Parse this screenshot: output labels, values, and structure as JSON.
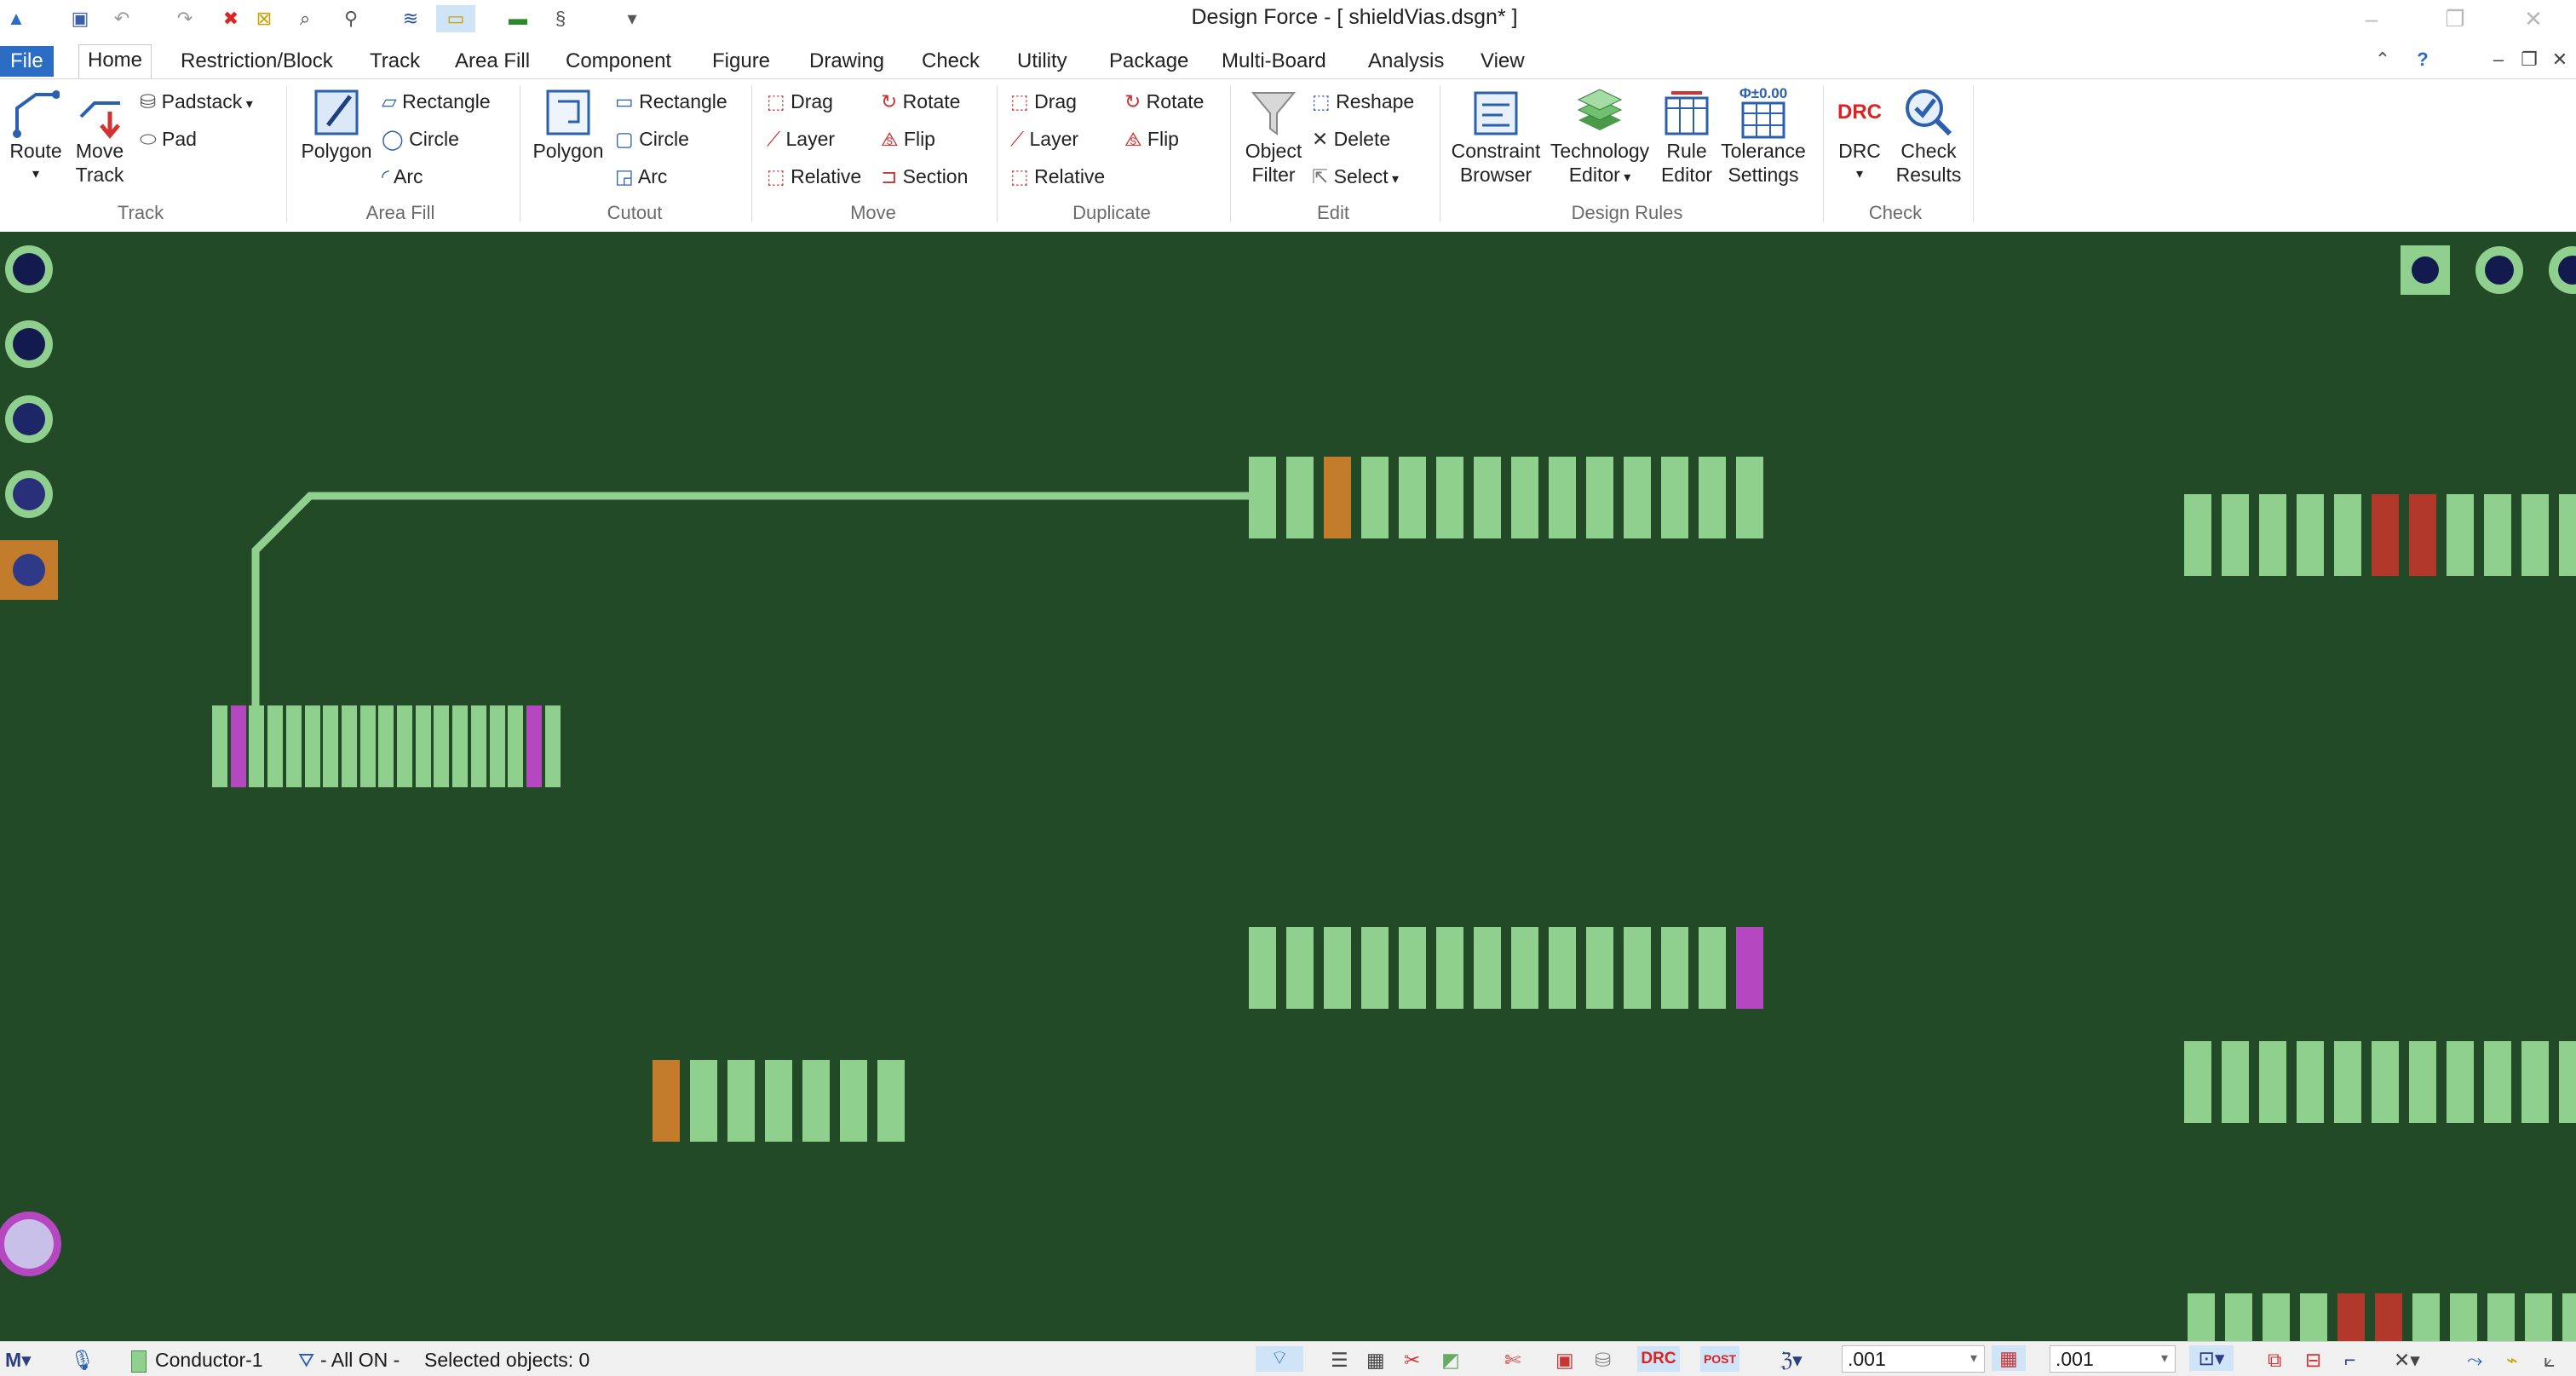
{
  "window": {
    "title": "Design Force - [ shieldVias.dsgn* ]",
    "controls": {
      "minimize": "–",
      "maximize": "❐",
      "close": "✕"
    }
  },
  "tabs": [
    "File",
    "Home",
    "Restriction/Block",
    "Track",
    "Area Fill",
    "Component",
    "Figure",
    "Drawing",
    "Check",
    "Utility",
    "Package",
    "Multi-Board",
    "Analysis",
    "View"
  ],
  "ribbon": {
    "track": {
      "route": "Route",
      "move": "Move",
      "track_label": "Track",
      "padstack": "Padstack",
      "pad": "Pad",
      "group": "Track"
    },
    "area_fill": {
      "polygon": "Polygon",
      "rectangle": "Rectangle",
      "circle": "Circle",
      "arc": "Arc",
      "group": "Area Fill"
    },
    "cutout": {
      "polygon": "Polygon",
      "rectangle": "Rectangle",
      "circle": "Circle",
      "arc": "Arc",
      "group": "Cutout"
    },
    "move": {
      "drag": "Drag",
      "layer": "Layer",
      "relative": "Relative",
      "rotate": "Rotate",
      "flip": "Flip",
      "section": "Section",
      "group": "Move"
    },
    "duplicate": {
      "drag": "Drag",
      "layer": "Layer",
      "relative": "Relative",
      "rotate": "Rotate",
      "flip": "Flip",
      "group": "Duplicate"
    },
    "edit": {
      "object": "Object",
      "filter": "Filter",
      "reshape": "Reshape",
      "delete": "Delete",
      "select": "Select",
      "group": "Edit"
    },
    "design_rules": {
      "constraint": "Constraint",
      "browser": "Browser",
      "technology": "Technology",
      "editor": "Editor",
      "rule": "Rule",
      "rule_editor": "Editor",
      "tolerance": "Tolerance",
      "settings": "Settings",
      "tol_badge": "Φ±0.00",
      "group": "Design Rules"
    },
    "check": {
      "drc": "DRC",
      "drc_badge": "DRC",
      "check": "Check",
      "results": "Results",
      "group": "Check"
    }
  },
  "status": {
    "layer": "Conductor-1",
    "filter": "- All ON -",
    "selected": "Selected objects: 0",
    "drc_badge": "DRC",
    "post_badge": "POST",
    "value1": ".001",
    "value2": ".001"
  },
  "colors": {
    "board": "#234a27",
    "pad": "#8fd08e",
    "pad_orange": "#c27c2b",
    "pad_magenta": "#b547c0",
    "pad_red": "#b3382c",
    "via_ring": "#8fd08e",
    "via_hole": "#131a4d",
    "accent": "#2b6cc4"
  }
}
